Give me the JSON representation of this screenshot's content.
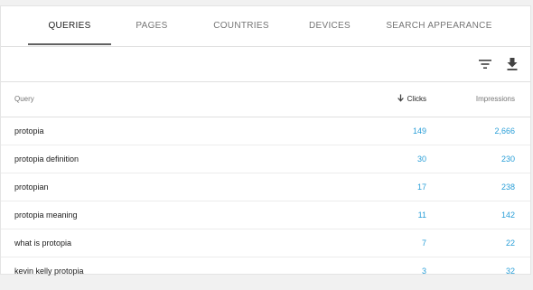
{
  "tabs": [
    {
      "label": "QUERIES",
      "active": true
    },
    {
      "label": "PAGES",
      "active": false
    },
    {
      "label": "COUNTRIES",
      "active": false
    },
    {
      "label": "DEVICES",
      "active": false
    },
    {
      "label": "SEARCH APPEARANCE",
      "active": false
    }
  ],
  "toolbar": {
    "filter_icon": "filter-icon",
    "download_icon": "download-icon"
  },
  "table": {
    "headers": {
      "query": "Query",
      "clicks": "Clicks",
      "impressions": "Impressions",
      "sort_icon": "arrow-down-icon"
    },
    "rows": [
      {
        "query": "protopia",
        "clicks": "149",
        "impressions": "2,666"
      },
      {
        "query": "protopia definition",
        "clicks": "30",
        "impressions": "230"
      },
      {
        "query": "protopian",
        "clicks": "17",
        "impressions": "238"
      },
      {
        "query": "protopia meaning",
        "clicks": "11",
        "impressions": "142"
      },
      {
        "query": "what is protopia",
        "clicks": "7",
        "impressions": "22"
      },
      {
        "query": "kevin kelly protopia",
        "clicks": "3",
        "impressions": "32"
      }
    ]
  },
  "colors": {
    "link_number": "#2a9fd8",
    "active_tab_underline": "#616161"
  }
}
